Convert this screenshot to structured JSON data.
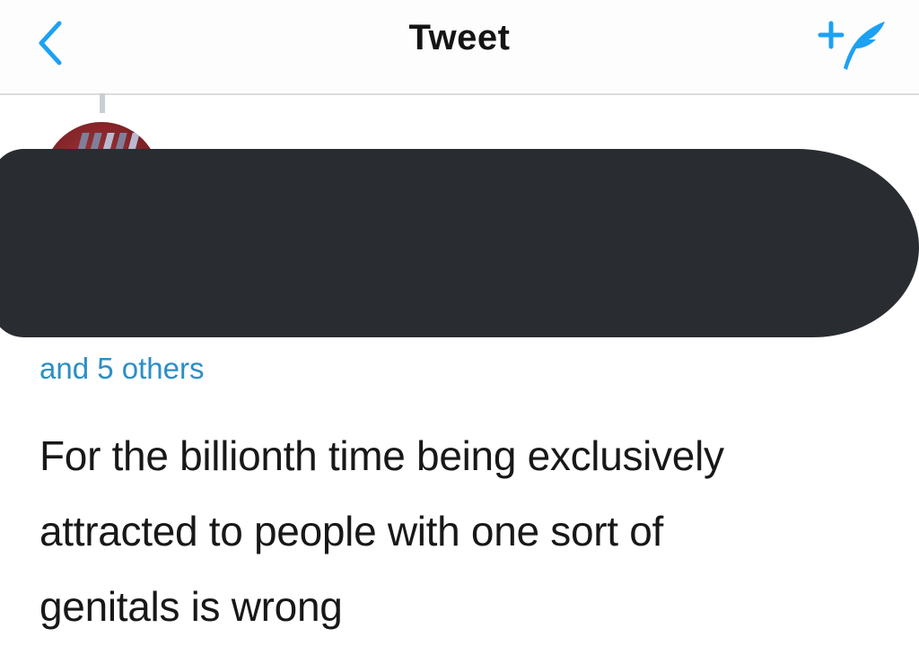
{
  "nav": {
    "title": "Tweet",
    "back_icon": "chevron-left-icon",
    "compose_icon": "compose-tweet-icon",
    "accent_color": "#1da1f2"
  },
  "tweet": {
    "replying_to": "and 5 others",
    "text_lines": [
      "For the billionth time being exclusively",
      "attracted to people with one sort of",
      "genitals is wrong"
    ]
  }
}
